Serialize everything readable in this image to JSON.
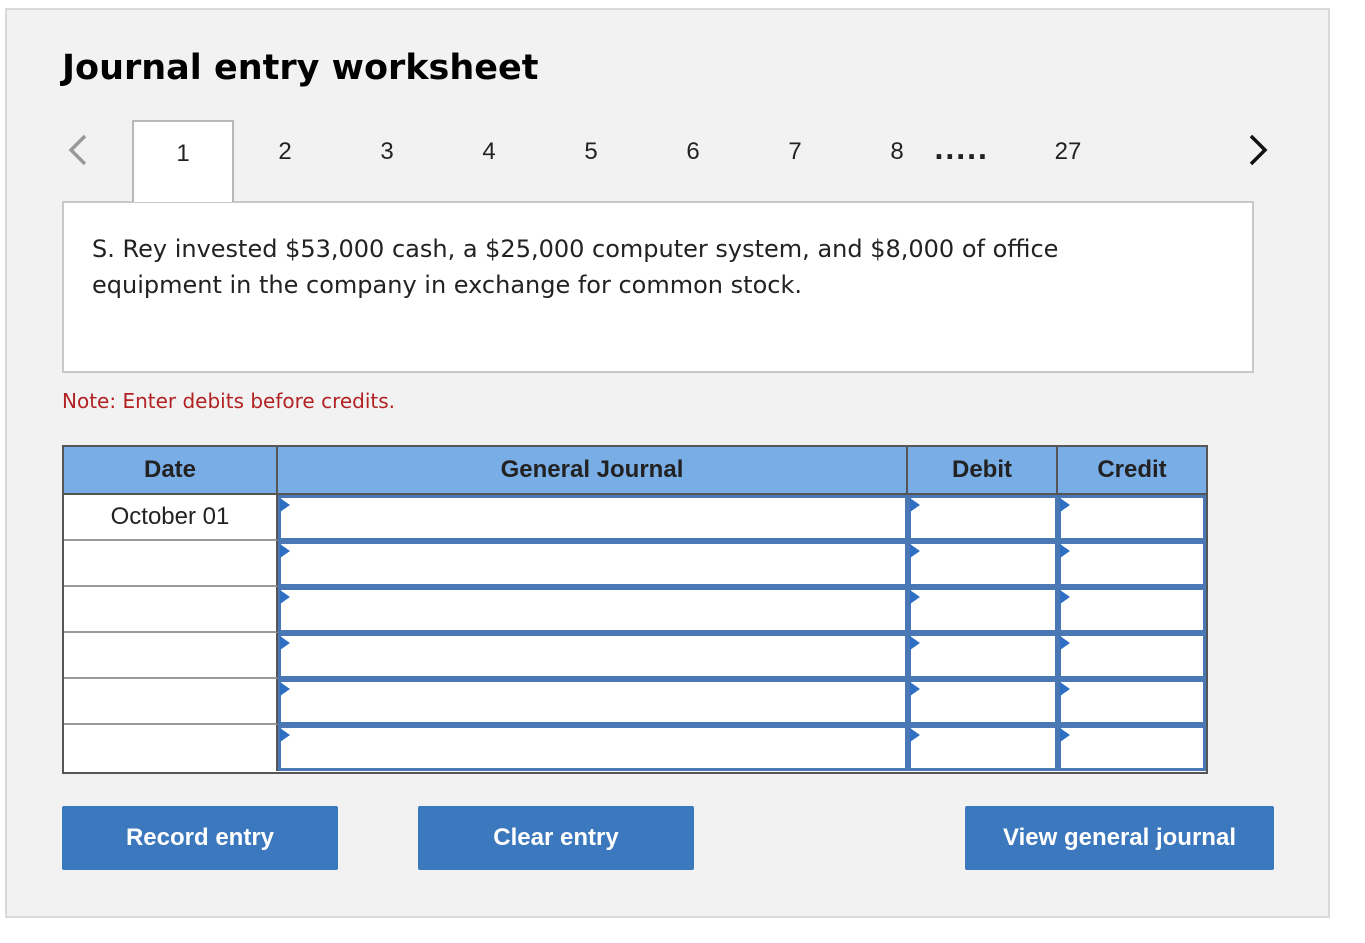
{
  "title": "Journal entry worksheet",
  "pagination": {
    "tabs": [
      "1",
      "2",
      "3",
      "4",
      "5",
      "6",
      "7",
      "8"
    ],
    "active": "1",
    "ellipsis": ".....",
    "last": "27"
  },
  "question": "S. Rey invested $53,000 cash, a $25,000 computer system, and $8,000 of office equipment in the company in exchange for common stock.",
  "note": "Note: Enter debits before credits.",
  "journal": {
    "headers": {
      "date": "Date",
      "general_journal": "General Journal",
      "debit": "Debit",
      "credit": "Credit"
    },
    "rows": [
      {
        "date": "October 01",
        "account": "",
        "debit": "",
        "credit": ""
      },
      {
        "date": "",
        "account": "",
        "debit": "",
        "credit": ""
      },
      {
        "date": "",
        "account": "",
        "debit": "",
        "credit": ""
      },
      {
        "date": "",
        "account": "",
        "debit": "",
        "credit": ""
      },
      {
        "date": "",
        "account": "",
        "debit": "",
        "credit": ""
      },
      {
        "date": "",
        "account": "",
        "debit": "",
        "credit": ""
      }
    ]
  },
  "buttons": {
    "record": "Record entry",
    "clear": "Clear entry",
    "view": "View general journal"
  },
  "icons": {
    "prev": "chevron-left-icon",
    "next": "chevron-right-icon"
  },
  "colors": {
    "header_bg": "#79ade6",
    "button_bg": "#3c78bd",
    "note": "#b22222",
    "cell_border": "#4a78b5"
  }
}
